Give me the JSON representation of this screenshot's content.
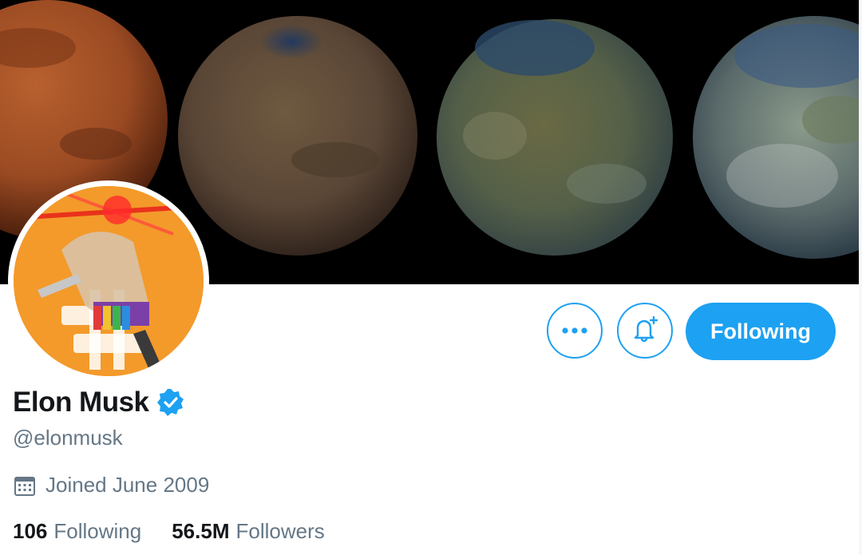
{
  "profile": {
    "name": "Elon Musk",
    "handle": "@elonmusk",
    "joined": "Joined June 2009",
    "verified": true
  },
  "actions": {
    "following_label": "Following"
  },
  "stats": {
    "following_count": "106",
    "following_label": "Following",
    "followers_count": "56.5M",
    "followers_label": "Followers"
  },
  "icons": {
    "more": "more-dots-icon",
    "notify": "bell-plus-icon",
    "verified": "verified-badge-icon",
    "calendar": "calendar-icon"
  },
  "colors": {
    "accent": "#1da1f2",
    "text": "#14171a",
    "secondary_text": "#657786",
    "avatar_bg": "#f39a2b"
  }
}
